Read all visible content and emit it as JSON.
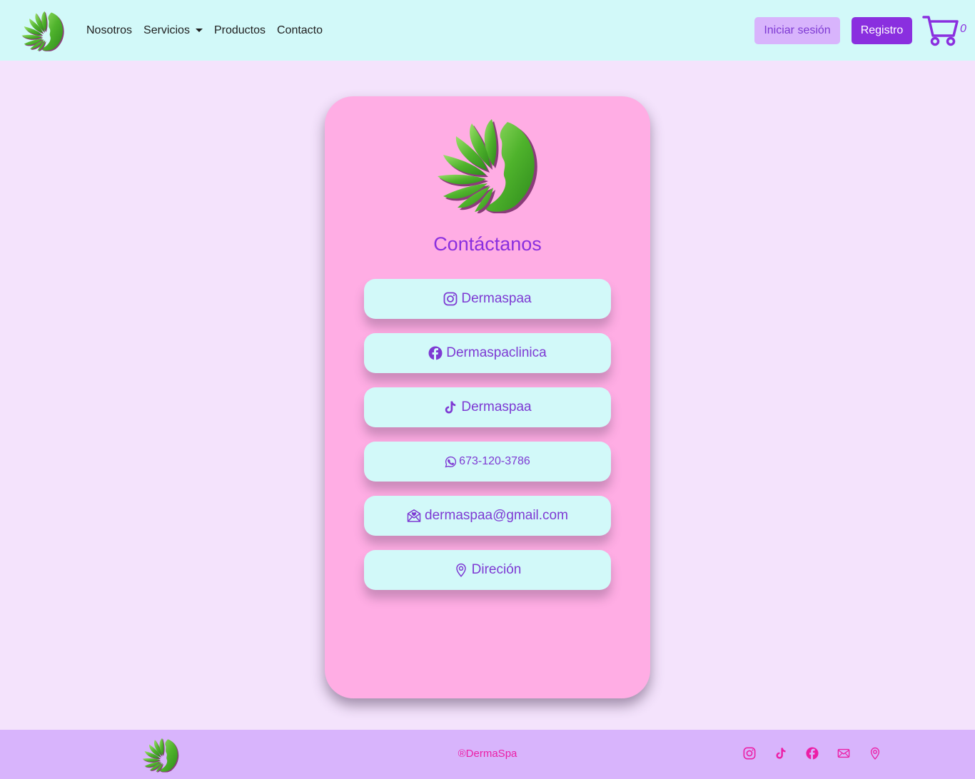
{
  "nav": {
    "links": [
      {
        "label": "Nosotros"
      },
      {
        "label": "Servicios"
      },
      {
        "label": "Productos"
      },
      {
        "label": "Contacto"
      }
    ],
    "login_label": "Iniciar sesión",
    "register_label": "Registro",
    "cart_count": "0",
    "cart_icon": "cart-icon"
  },
  "contact": {
    "title": "Contáctanos",
    "items": [
      {
        "icon": "instagram-icon",
        "label": "Dermaspaa"
      },
      {
        "icon": "facebook-icon",
        "label": "Dermaspaclinica"
      },
      {
        "icon": "tiktok-icon",
        "label": "Dermaspaa"
      },
      {
        "icon": "whatsapp-icon",
        "label": "673-120-3786"
      },
      {
        "icon": "envelope-heart-icon",
        "label": "dermaspaa@gmail.com"
      },
      {
        "icon": "location-pin-icon",
        "label": "Direción"
      }
    ]
  },
  "footer": {
    "copyright": "®DermaSpa",
    "icons": [
      "instagram-icon",
      "tiktok-icon",
      "facebook-icon",
      "envelope-icon",
      "location-pin-icon"
    ]
  },
  "colors": {
    "navbar_bg": "#d2f9f9",
    "page_bg": "#f4e3fc",
    "card_bg": "#ffade4",
    "accent_purple": "#8a2fdf",
    "footer_bg": "#d8b4fc",
    "footer_text": "#ec1fa6",
    "leaf_green": "#5ec23a"
  }
}
